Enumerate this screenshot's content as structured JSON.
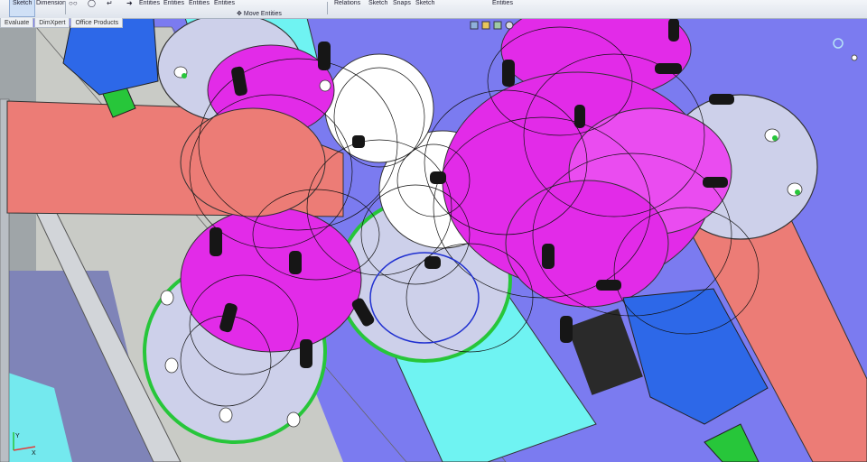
{
  "commandmanager": {
    "items": [
      {
        "label": "Sketch"
      },
      {
        "label": "Dimension"
      },
      {
        "label": "Entities"
      },
      {
        "label": "Entities"
      },
      {
        "label": "Entities"
      },
      {
        "label": "Move Entities"
      },
      {
        "label": "Relations"
      },
      {
        "label": "Sketch"
      },
      {
        "label": "Snaps"
      },
      {
        "label": "Sketch"
      },
      {
        "label": "Entities"
      }
    ]
  },
  "tabs": [
    {
      "label": "Evaluate"
    },
    {
      "label": "DimXpert"
    },
    {
      "label": "Office Products"
    }
  ],
  "viewport": {
    "background": "#7b7bf0",
    "colors": {
      "magenta": "#e22be8",
      "cyan": "#6ff3f2",
      "salmon": "#ec7c76",
      "blue": "#2d68e8",
      "flange": "#cdd0ea",
      "green": "#27c63a"
    }
  },
  "axes": {
    "x": "X",
    "y": "Y"
  }
}
